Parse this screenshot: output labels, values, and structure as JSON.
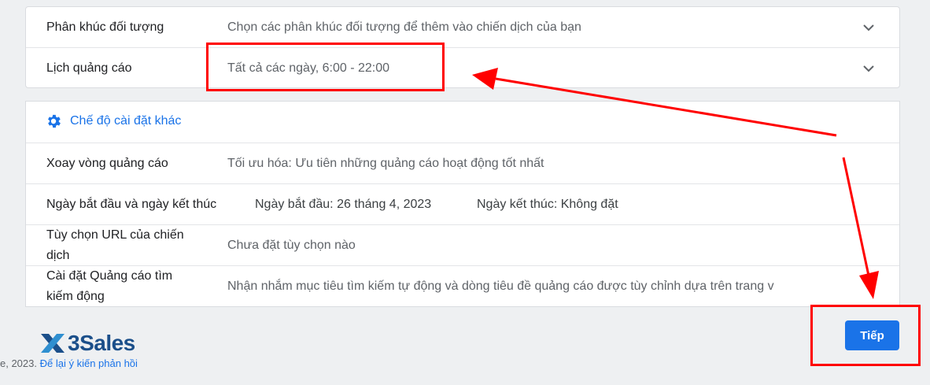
{
  "top_card": {
    "rows": [
      {
        "label": "Phân khúc đối tượng",
        "value": "Chọn các phân khúc đối tượng để thêm vào chiến dịch của bạn"
      },
      {
        "label": "Lịch quảng cáo",
        "value": "Tất cả các ngày, 6:00 - 22:00"
      }
    ]
  },
  "settings_card": {
    "header": "Chế độ cài đặt khác",
    "rotation": {
      "label": "Xoay vòng quảng cáo",
      "value": "Tối ưu hóa: Ưu tiên những quảng cáo hoạt động tốt nhất"
    },
    "dates": {
      "label": "Ngày bắt đầu và ngày kết thúc",
      "start": "Ngày bắt đầu: 26 tháng 4, 2023",
      "end": "Ngày kết thúc: Không đặt"
    },
    "url": {
      "label_line1": "Tùy chọn URL của chiến",
      "label_line2": "dịch",
      "value": "Chưa đặt tùy chọn nào"
    },
    "dsa": {
      "label_line1": "Cài đặt Quảng cáo tìm",
      "label_line2": "kiếm động",
      "value": "Nhận nhắm mục tiêu tìm kiếm tự động và dòng tiêu đề quảng cáo được tùy chỉnh dựa trên trang v"
    }
  },
  "next_button": "Tiếp",
  "logo": {
    "text": "3Sales"
  },
  "footer": {
    "prefix": "e, 2023.",
    "link": "Để lại ý kiến phản hồi"
  },
  "colors": {
    "accent": "#1a73e8",
    "annotation": "#ff0000",
    "logo": "#1b4f8a"
  }
}
